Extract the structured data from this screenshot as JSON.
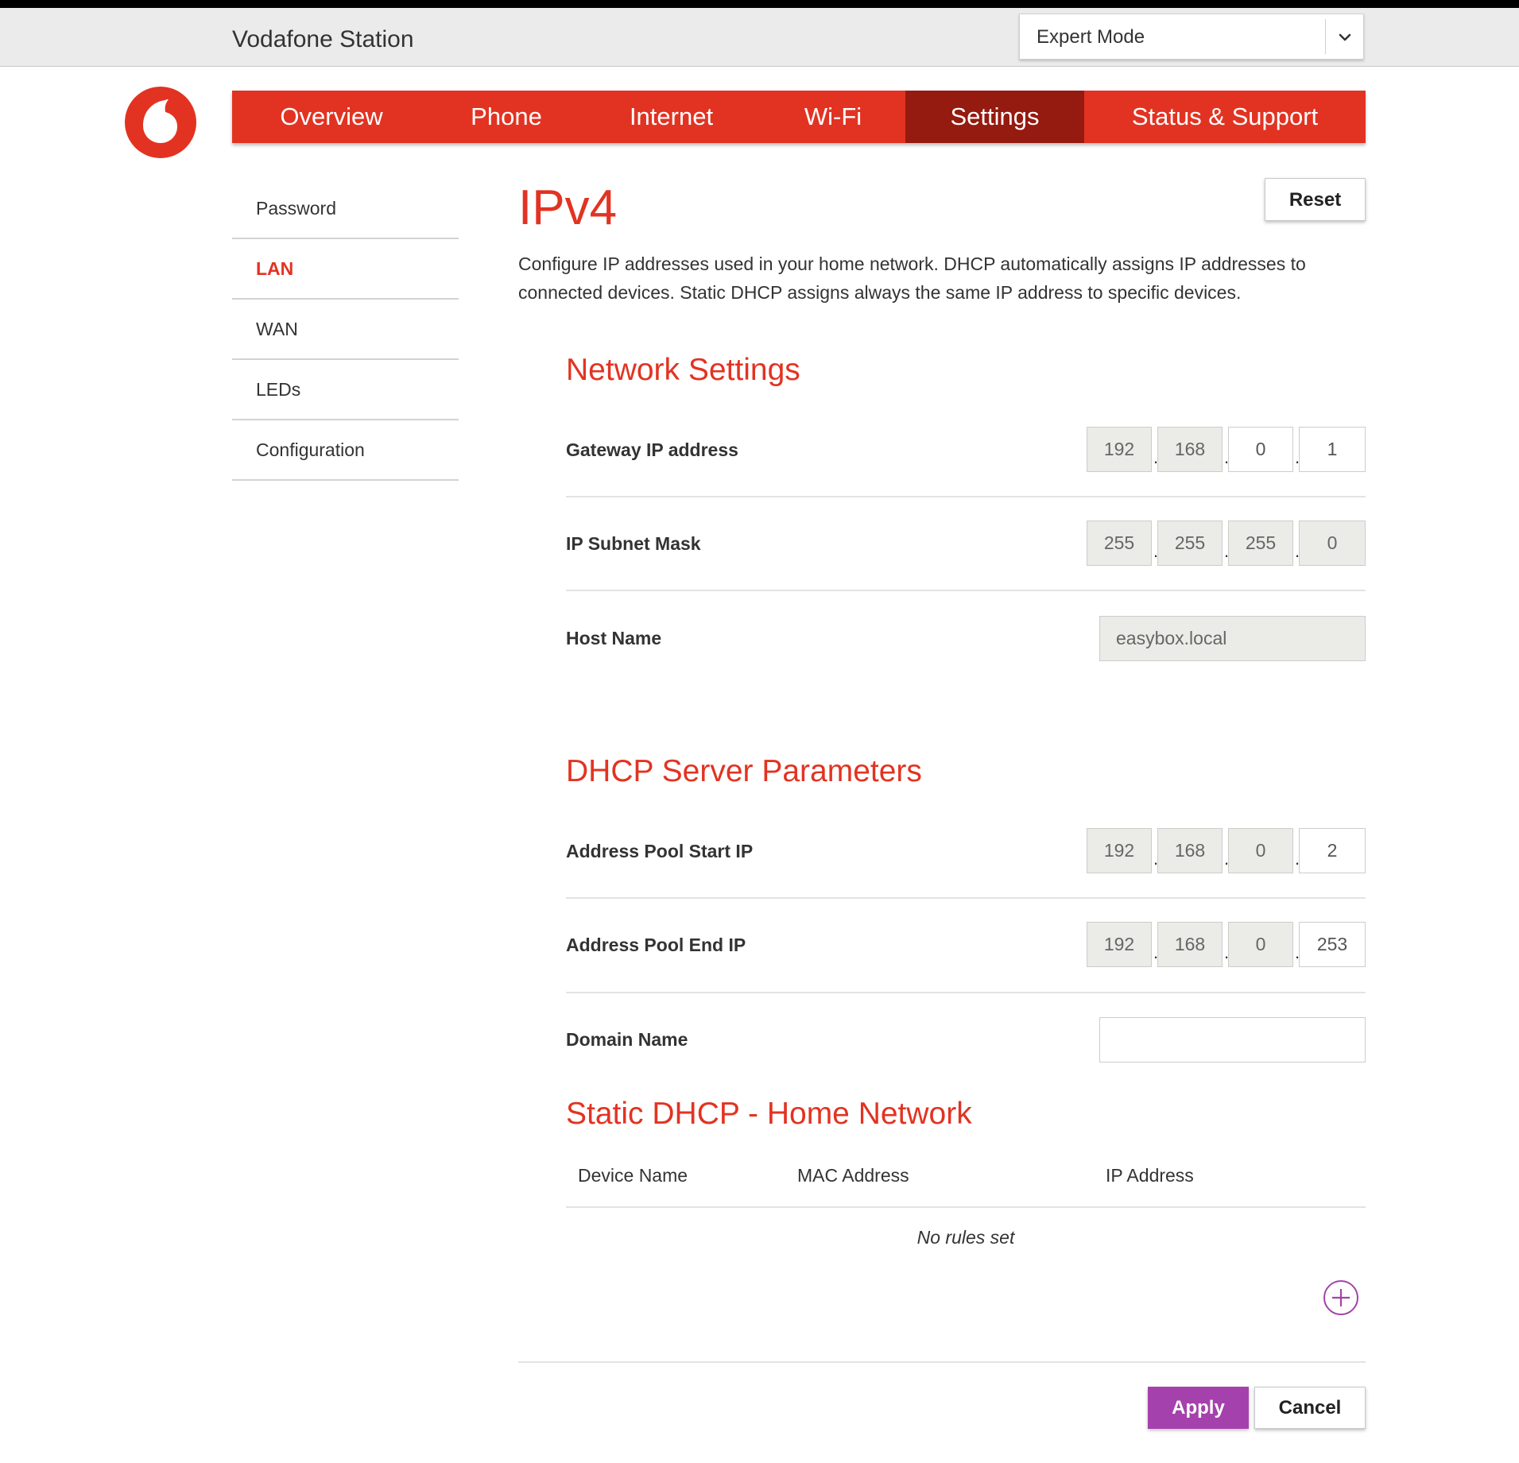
{
  "header": {
    "app_title": "Vodafone Station",
    "mode_select": {
      "value": "Expert Mode",
      "icon": "chevron-down-icon"
    }
  },
  "logo": {
    "icon": "vodafone-logo-icon",
    "color": "#e23322"
  },
  "nav": {
    "items": [
      {
        "label": "Overview"
      },
      {
        "label": "Phone"
      },
      {
        "label": "Internet"
      },
      {
        "label": "Wi-Fi"
      },
      {
        "label": "Settings",
        "active": true
      },
      {
        "label": "Status & Support"
      }
    ]
  },
  "sidebar": {
    "items": [
      {
        "label": "Password"
      },
      {
        "label": "LAN",
        "active": true
      },
      {
        "label": "WAN"
      },
      {
        "label": "LEDs"
      },
      {
        "label": "Configuration"
      }
    ]
  },
  "page": {
    "title": "IPv4",
    "reset_label": "Reset",
    "description": "Configure IP addresses used in your home network. DHCP automatically assigns IP addresses to connected devices. Static DHCP assigns always the same IP address to specific devices."
  },
  "network_settings": {
    "title": "Network Settings",
    "gateway": {
      "label": "Gateway IP address",
      "octets": [
        "192",
        "168",
        "0",
        "1"
      ]
    },
    "subnet": {
      "label": "IP Subnet Mask",
      "octets": [
        "255",
        "255",
        "255",
        "0"
      ]
    },
    "host": {
      "label": "Host Name",
      "value": "easybox.local"
    }
  },
  "dhcp": {
    "title": "DHCP Server Parameters",
    "start": {
      "label": "Address Pool Start IP",
      "octets": [
        "192",
        "168",
        "0",
        "2"
      ]
    },
    "end": {
      "label": "Address Pool End IP",
      "octets": [
        "192",
        "168",
        "0",
        "253"
      ]
    },
    "domain": {
      "label": "Domain Name",
      "value": ""
    }
  },
  "static_dhcp": {
    "title": "Static DHCP - Home Network",
    "columns": [
      "Device Name",
      "MAC Address",
      "IP Address"
    ],
    "empty_message": "No rules set",
    "add_icon": "plus-circle-icon"
  },
  "footer": {
    "apply_label": "Apply",
    "cancel_label": "Cancel"
  },
  "colors": {
    "brand_red": "#e23322",
    "nav_active": "#951a10",
    "apply_purple": "#a541ac",
    "readonly_field": "#ebebe7"
  }
}
